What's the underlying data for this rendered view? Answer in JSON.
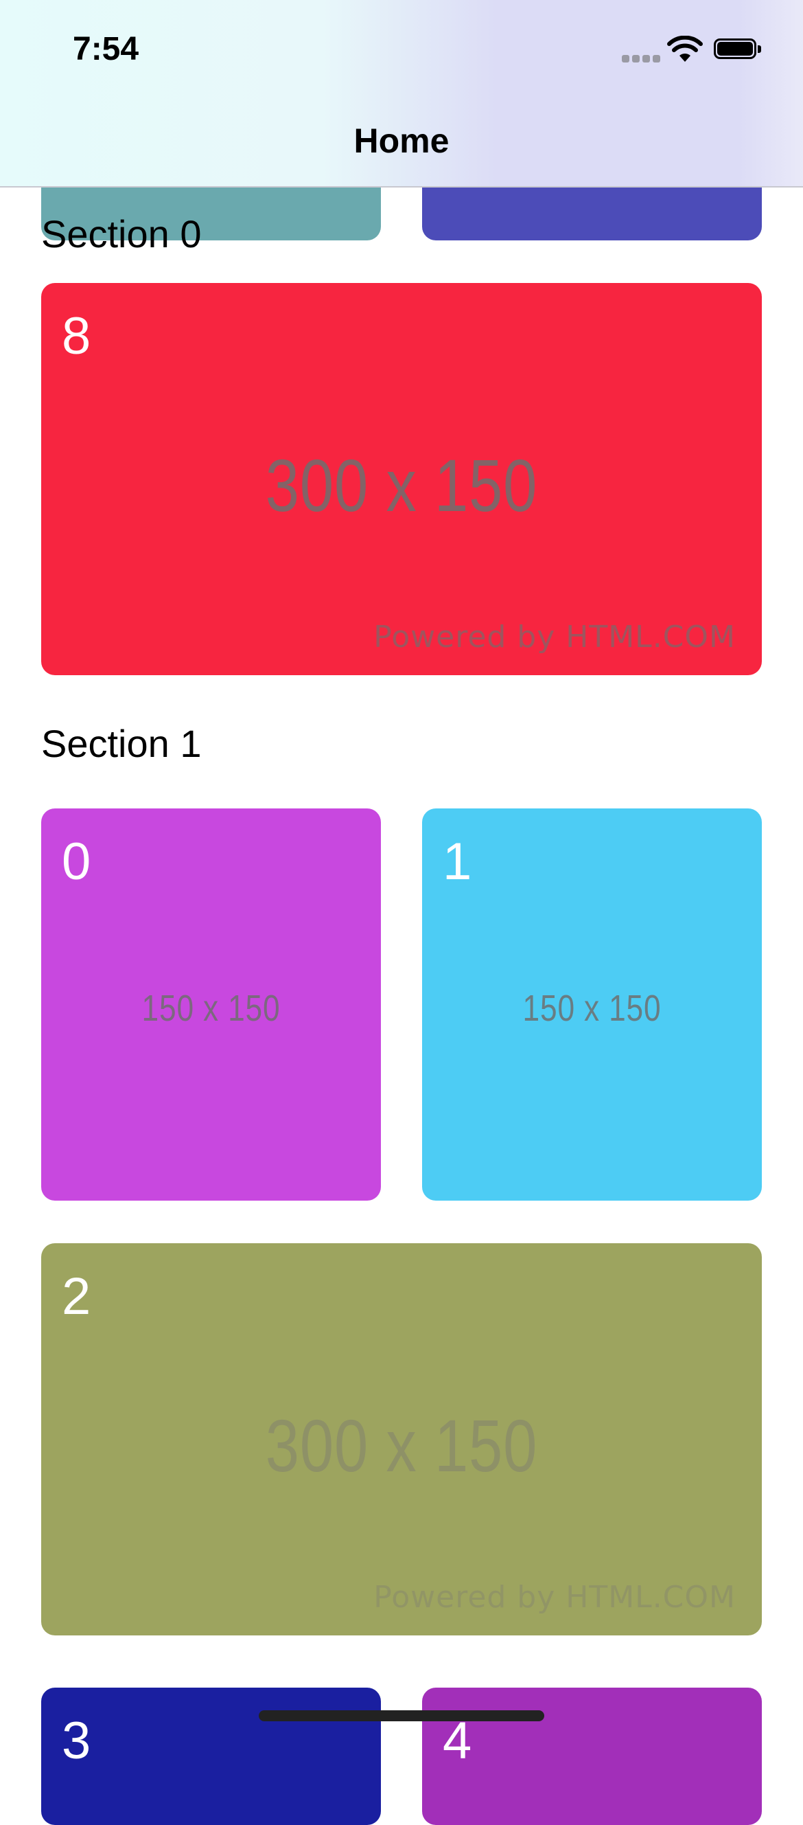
{
  "status_bar": {
    "time": "7:54",
    "icons": [
      "cellular-signal-icon",
      "wifi-icon",
      "battery-icon"
    ]
  },
  "nav": {
    "title": "Home"
  },
  "sections": [
    {
      "title": "Section 0",
      "items": [
        {
          "number": "",
          "color": "#6aa9ae"
        },
        {
          "number": "",
          "color": "#4c4cb8"
        },
        {
          "number": "8",
          "color": "#f72540",
          "placeholder": "300 x 150",
          "powered": "Powered by HTML.COM"
        }
      ]
    },
    {
      "title": "Section 1",
      "items": [
        {
          "number": "0",
          "color": "#c848df",
          "placeholder": "150 x 150"
        },
        {
          "number": "1",
          "color": "#4dccf4",
          "placeholder": "150 x 150"
        },
        {
          "number": "2",
          "color": "#9da45f",
          "placeholder": "300 x 150",
          "powered": "Powered by HTML.COM"
        },
        {
          "number": "3",
          "color": "#1a1fa0"
        },
        {
          "number": "4",
          "color": "#a22fb9"
        }
      ]
    }
  ]
}
